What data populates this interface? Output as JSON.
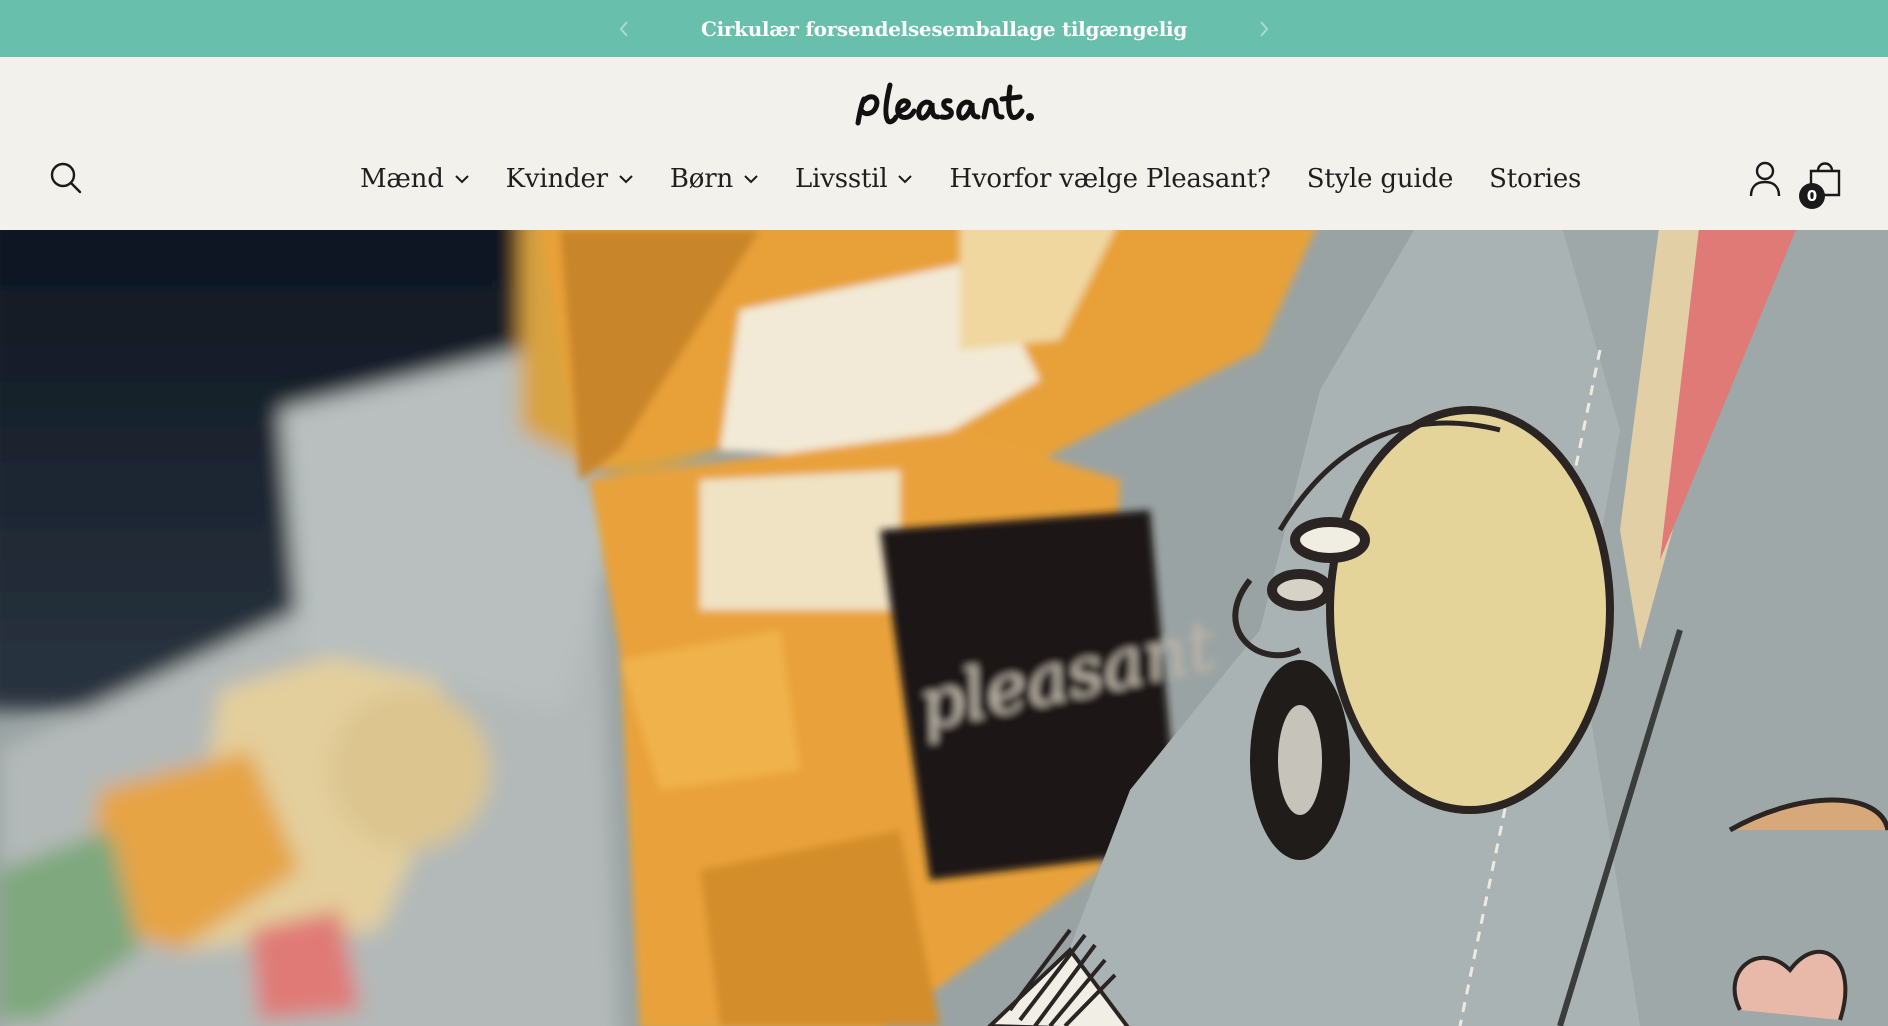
{
  "announcement": {
    "text": "Cirkulær forsendelsesemballage tilgængelig",
    "prev_icon": "chevron-left-icon",
    "next_icon": "chevron-right-icon",
    "background": "#68bfac"
  },
  "header": {
    "logo_text": "pleasant.",
    "search_icon": "search-icon",
    "account_icon": "user-icon",
    "cart_icon": "shopping-bag-icon",
    "cart_count": "0"
  },
  "nav": {
    "items": [
      {
        "label": "Mænd",
        "has_dropdown": true
      },
      {
        "label": "Kvinder",
        "has_dropdown": true
      },
      {
        "label": "Børn",
        "has_dropdown": true
      },
      {
        "label": "Livsstil",
        "has_dropdown": true
      },
      {
        "label": "Hvorfor vælge Pleasant?",
        "has_dropdown": false
      },
      {
        "label": "Style guide",
        "has_dropdown": false
      },
      {
        "label": "Stories",
        "has_dropdown": false
      }
    ]
  },
  "hero": {
    "label_text": "pleasant",
    "colors": {
      "fabric": "#a7b1b1",
      "orange": "#e8a138",
      "cream": "#efe3c4",
      "dark": "#1b1917",
      "pink": "#e07a77"
    }
  }
}
